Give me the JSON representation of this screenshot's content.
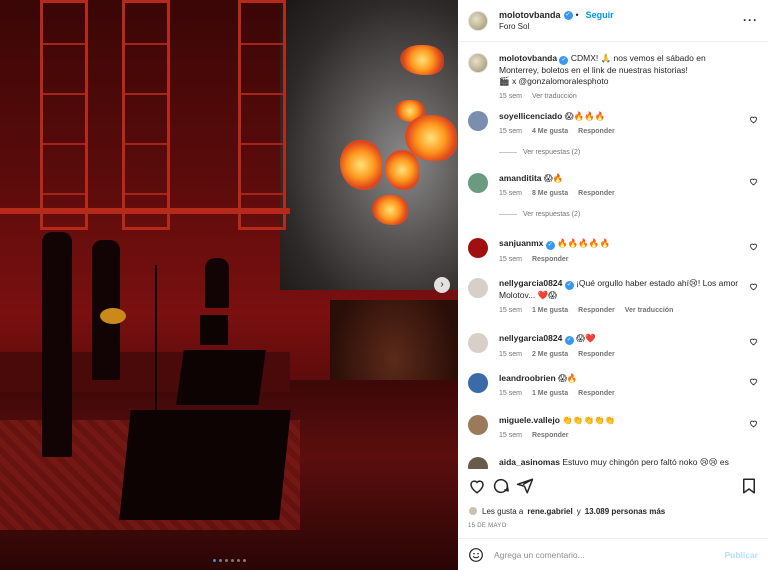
{
  "post": {
    "username": "molotovbanda",
    "follow_label": "Seguir",
    "location": "Foro Sol",
    "more_label": "···",
    "caption": "CDMX! 🙏 nos vemos el sábado en Monterrey, boletos en el link de nuestras historias!",
    "caption_credit": "🎬 x @gonzalomoralesphoto",
    "caption_time": "15 sem",
    "translate_label": "Ver traducción"
  },
  "comments": [
    {
      "user": "soyellicenciado",
      "verified": false,
      "text": "😱🔥🔥🔥",
      "time": "15 sem",
      "likes": "4 Me gusta",
      "reply": "Responder",
      "view_replies": "Ver respuestas (2)",
      "color": "#7a8fb0"
    },
    {
      "user": "amanditita",
      "verified": false,
      "text": "😱🔥",
      "time": "15 sem",
      "likes": "8 Me gusta",
      "reply": "Responder",
      "view_replies": "Ver respuestas (2)",
      "color": "#6a9a80"
    },
    {
      "user": "sanjuanmx",
      "verified": true,
      "text": "🔥🔥🔥🔥🔥",
      "time": "15 sem",
      "likes": "",
      "reply": "Responder",
      "color": "#a01010"
    },
    {
      "user": "nellygarcia0824",
      "verified": true,
      "text": "¡Qué orgullo haber estado ahí😢! Los amor Molotov... ❤️😱",
      "time": "15 sem",
      "likes": "1 Me gusta",
      "reply": "Responder",
      "translate": "Ver traducción",
      "color": "#d8d0c8"
    },
    {
      "user": "nellygarcia0824",
      "verified": true,
      "text": "😱❤️",
      "time": "15 sem",
      "likes": "2 Me gusta",
      "reply": "Responder",
      "color": "#d8d0c8"
    },
    {
      "user": "leandroobrien",
      "verified": false,
      "text": "😱🔥",
      "time": "15 sem",
      "likes": "1 Me gusta",
      "reply": "Responder",
      "color": "#3a6aa8"
    },
    {
      "user": "miguele.vallejo",
      "verified": false,
      "text": "👏👏👏👏👏",
      "time": "15 sem",
      "likes": "",
      "reply": "Responder",
      "color": "#9a7a5a"
    },
    {
      "user": "aida_asinomas",
      "verified": false,
      "text": "Estuvo muy chingón pero faltó noko 😢😢 es",
      "time": "",
      "likes": "",
      "reply": "",
      "color": "#6a5a4a"
    }
  ],
  "likes_summary": {
    "prefix": "Les gusta a",
    "user": "rene.gabriel",
    "middle": "y",
    "count": "13.089 personas más"
  },
  "date_label": "15 DE MAYO",
  "add_comment": {
    "placeholder": "Agrega un comentario...",
    "post_label": "Publicar"
  },
  "carousel": {
    "slides": 6,
    "active_index": 0
  }
}
